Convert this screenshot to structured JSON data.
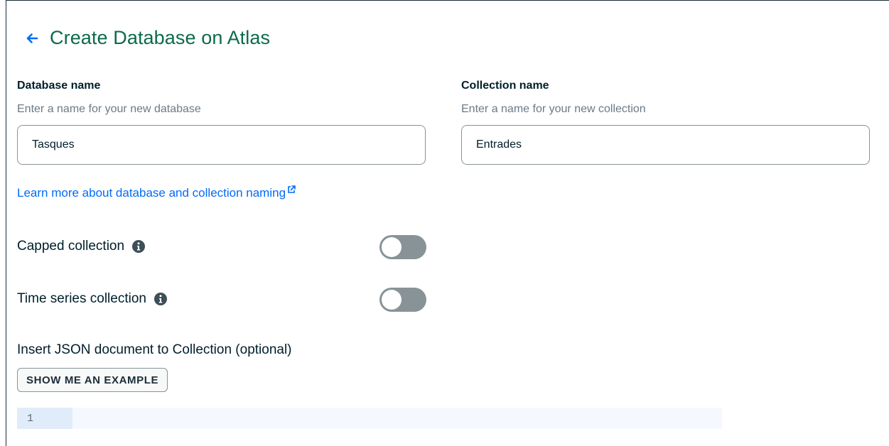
{
  "header": {
    "title": "Create Database on Atlas",
    "back_icon": "arrow-left-icon"
  },
  "database": {
    "label": "Database name",
    "description": "Enter a name for your new database",
    "value": "Tasques"
  },
  "collection": {
    "label": "Collection name",
    "description": "Enter a name for your new collection",
    "value": "Entrades"
  },
  "naming_link": {
    "text": "Learn more about database and collection naming",
    "icon": "external-link-icon"
  },
  "options": {
    "capped": {
      "label": "Capped collection",
      "enabled": false,
      "icon": "info-icon"
    },
    "time_series": {
      "label": "Time series collection",
      "enabled": false,
      "icon": "info-icon"
    }
  },
  "json_document": {
    "label": "Insert JSON document to Collection (optional)",
    "example_button": "SHOW ME AN EXAMPLE",
    "line_number": "1"
  },
  "colors": {
    "title": "#0b6b4a",
    "link": "#016bf8",
    "toggle_off": "#889397",
    "editor_bg": "#f5f9ff",
    "gutter_bg": "#e1ecfa"
  }
}
